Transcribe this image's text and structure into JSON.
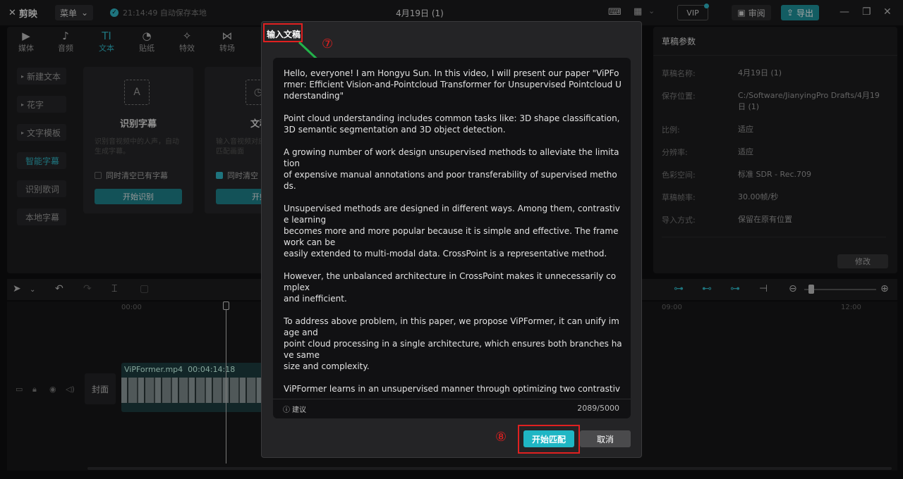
{
  "app": {
    "name": "剪映",
    "menu_label": "菜单",
    "autosave": "21:14:49 自动保存本地",
    "doc_title": "4月19日 (1)",
    "vip_label": "VIP",
    "review_label": "审阅",
    "export_label": "导出"
  },
  "top_tabs": [
    {
      "icon": "▶",
      "label": "媒体"
    },
    {
      "icon": "♪",
      "label": "音频"
    },
    {
      "icon": "TI",
      "label": "文本"
    },
    {
      "icon": "◔",
      "label": "贴纸"
    },
    {
      "icon": "✧",
      "label": "特效"
    },
    {
      "icon": "⋈",
      "label": "转场"
    }
  ],
  "side_items": [
    {
      "label": "新建文本"
    },
    {
      "label": "花字"
    },
    {
      "label": "文字模板"
    },
    {
      "label": "智能字幕"
    },
    {
      "label": "识别歌词"
    },
    {
      "label": "本地字幕"
    }
  ],
  "cards": [
    {
      "icon": "A",
      "title": "识别字幕",
      "desc": "识别音视频中的人声，自动生成字幕。",
      "checkbox": "同时清空已有字幕",
      "button": "开始识别"
    },
    {
      "icon": "◷",
      "title": "文稿",
      "desc": "输入音视频对应文稿，自动匹配画面",
      "checkbox": "同时清空",
      "button": "开始"
    }
  ],
  "right_panel": {
    "title": "草稿参数",
    "rows": [
      {
        "label": "草稿名称:",
        "value": "4月19日 (1)"
      },
      {
        "label": "保存位置:",
        "value": "C:/Software/JianyingPro Drafts/4月19日 (1)"
      },
      {
        "label": "比例:",
        "value": "适应"
      },
      {
        "label": "分辨率:",
        "value": "适应"
      },
      {
        "label": "色彩空间:",
        "value": "标准 SDR - Rec.709"
      },
      {
        "label": "草稿帧率:",
        "value": "30.00帧/秒"
      },
      {
        "label": "导入方式:",
        "value": "保留在原有位置"
      }
    ],
    "modify_label": "修改"
  },
  "timeline": {
    "ticks": [
      "00:00",
      "09:00",
      "12:00"
    ],
    "cover_label": "封面",
    "clip_name": "ViPFormer.mp4",
    "clip_duration": "00:04:14:18"
  },
  "dialog": {
    "title": "输入文稿",
    "text": "Hello, everyone! I am Hongyu Sun. In this video, I will present our paper \"ViPFormer: Efficient Vision-and-Pointcloud Transformer for Unsupervised Pointcloud Understanding\"\n\nPoint cloud understanding includes common tasks like: 3D shape classification, 3D semantic segmentation and 3D object detection.\n\nA growing number of work design unsupervised methods to alleviate the limitation\nof expensive manual annotations and poor transferability of supervised methods.\n\nUnsupervised methods are designed in different ways. Among them, contrastive learning\nbecomes more and more popular because it is simple and effective. The framework can be\neasily extended to multi-modal data. CrossPoint is a representative method.\n\nHowever, the unbalanced architecture in CrossPoint makes it unnecessarily complex\nand inefficient.\n\nTo address above problem, in this paper, we propose ViPFormer, it can unify image and\npoint cloud processing in a single architecture, which ensures both branches have same\nsize and complexity.\n\nViPFormer learns in an unsupervised manner through optimizing two contrastive objectives.",
    "suggest_label": "建议",
    "counter": "2089/5000",
    "start_label": "开始匹配",
    "cancel_label": "取消"
  },
  "annotations": {
    "step7": "⑦",
    "step8": "⑧"
  },
  "colors": {
    "accent": "#1fb6c4",
    "annotation": "#e02020"
  }
}
